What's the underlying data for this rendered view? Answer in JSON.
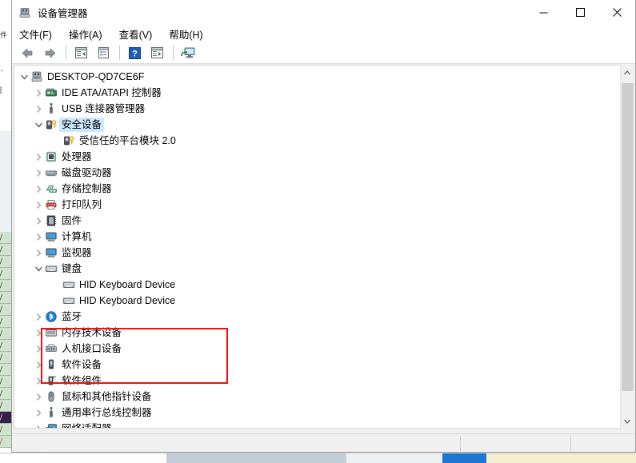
{
  "window": {
    "title": "设备管理器",
    "icon": "device-manager-icon",
    "controls": {
      "minimize": "—",
      "maximize": "□",
      "close": "✕"
    }
  },
  "menubar": {
    "items": [
      {
        "label": "文件(F)",
        "name": "menu-file"
      },
      {
        "label": "操作(A)",
        "name": "menu-action"
      },
      {
        "label": "查看(V)",
        "name": "menu-view"
      },
      {
        "label": "帮助(H)",
        "name": "menu-help"
      }
    ]
  },
  "toolbar": {
    "buttons": [
      {
        "icon": "back-arrow-icon",
        "name": "toolbar-back"
      },
      {
        "icon": "forward-arrow-icon",
        "name": "toolbar-forward"
      },
      {
        "icon": "show-hide-tree-icon",
        "name": "toolbar-show-hide-console-tree"
      },
      {
        "icon": "properties-icon",
        "name": "toolbar-properties"
      },
      {
        "icon": "help-icon",
        "name": "toolbar-help"
      },
      {
        "icon": "update-driver-icon",
        "name": "toolbar-update-driver"
      },
      {
        "icon": "scan-hardware-icon",
        "name": "toolbar-scan-for-hardware-changes"
      }
    ]
  },
  "tree": {
    "root": {
      "label": "DESKTOP-QD7CE6F",
      "icon": "computer-root-icon",
      "expanded": true
    },
    "items": [
      {
        "label": "IDE ATA/ATAPI 控制器",
        "icon": "ide-controller-icon",
        "depth": 1,
        "expander": "collapsed",
        "selected": false
      },
      {
        "label": "USB 连接器管理器",
        "icon": "usb-icon",
        "depth": 1,
        "expander": "collapsed",
        "selected": false
      },
      {
        "label": "安全设备",
        "icon": "security-device-icon",
        "depth": 1,
        "expander": "expanded",
        "selected": true
      },
      {
        "label": "受信任的平台模块 2.0",
        "icon": "security-device-icon",
        "depth": 2,
        "expander": "none",
        "selected": false
      },
      {
        "label": "处理器",
        "icon": "processor-icon",
        "depth": 1,
        "expander": "collapsed",
        "selected": false
      },
      {
        "label": "磁盘驱动器",
        "icon": "disk-drive-icon",
        "depth": 1,
        "expander": "collapsed",
        "selected": false
      },
      {
        "label": "存储控制器",
        "icon": "storage-controller-icon",
        "depth": 1,
        "expander": "collapsed",
        "selected": false
      },
      {
        "label": "打印队列",
        "icon": "printer-icon",
        "depth": 1,
        "expander": "collapsed",
        "selected": false
      },
      {
        "label": "固件",
        "icon": "firmware-icon",
        "depth": 1,
        "expander": "collapsed",
        "selected": false
      },
      {
        "label": "计算机",
        "icon": "computer-icon",
        "depth": 1,
        "expander": "collapsed",
        "selected": false
      },
      {
        "label": "监视器",
        "icon": "monitor-icon",
        "depth": 1,
        "expander": "collapsed",
        "selected": false
      },
      {
        "label": "键盘",
        "icon": "keyboard-icon",
        "depth": 1,
        "expander": "expanded",
        "selected": false
      },
      {
        "label": "HID Keyboard Device",
        "icon": "keyboard-icon",
        "depth": 2,
        "expander": "none",
        "selected": false
      },
      {
        "label": "HID Keyboard Device",
        "icon": "keyboard-icon",
        "depth": 2,
        "expander": "none",
        "selected": false
      },
      {
        "label": "蓝牙",
        "icon": "bluetooth-icon",
        "depth": 1,
        "expander": "collapsed",
        "selected": false
      },
      {
        "label": "内存技术设备",
        "icon": "memory-device-icon",
        "depth": 1,
        "expander": "collapsed",
        "selected": false
      },
      {
        "label": "人机接口设备",
        "icon": "hid-device-icon",
        "depth": 1,
        "expander": "collapsed",
        "selected": false
      },
      {
        "label": "软件设备",
        "icon": "software-device-icon",
        "depth": 1,
        "expander": "collapsed",
        "selected": false
      },
      {
        "label": "软件组件",
        "icon": "software-component-icon",
        "depth": 1,
        "expander": "collapsed",
        "selected": false
      },
      {
        "label": "鼠标和其他指针设备",
        "icon": "mouse-icon",
        "depth": 1,
        "expander": "collapsed",
        "selected": false
      },
      {
        "label": "通用串行总线控制器",
        "icon": "usb-icon",
        "depth": 1,
        "expander": "collapsed",
        "selected": false
      },
      {
        "label": "网络适配器",
        "icon": "network-adapter-icon",
        "depth": 1,
        "expander": "collapsed",
        "selected": false
      }
    ]
  },
  "annotation": {
    "type": "red-rectangle-highlight",
    "color": "#ee1111",
    "target": "键盘"
  },
  "statusbar": {
    "text": ""
  },
  "colors": {
    "selection": "#cce8ff",
    "annotation": "#ee1111",
    "window_bg": "#f0f0f0",
    "pane_bg": "#ffffff"
  }
}
